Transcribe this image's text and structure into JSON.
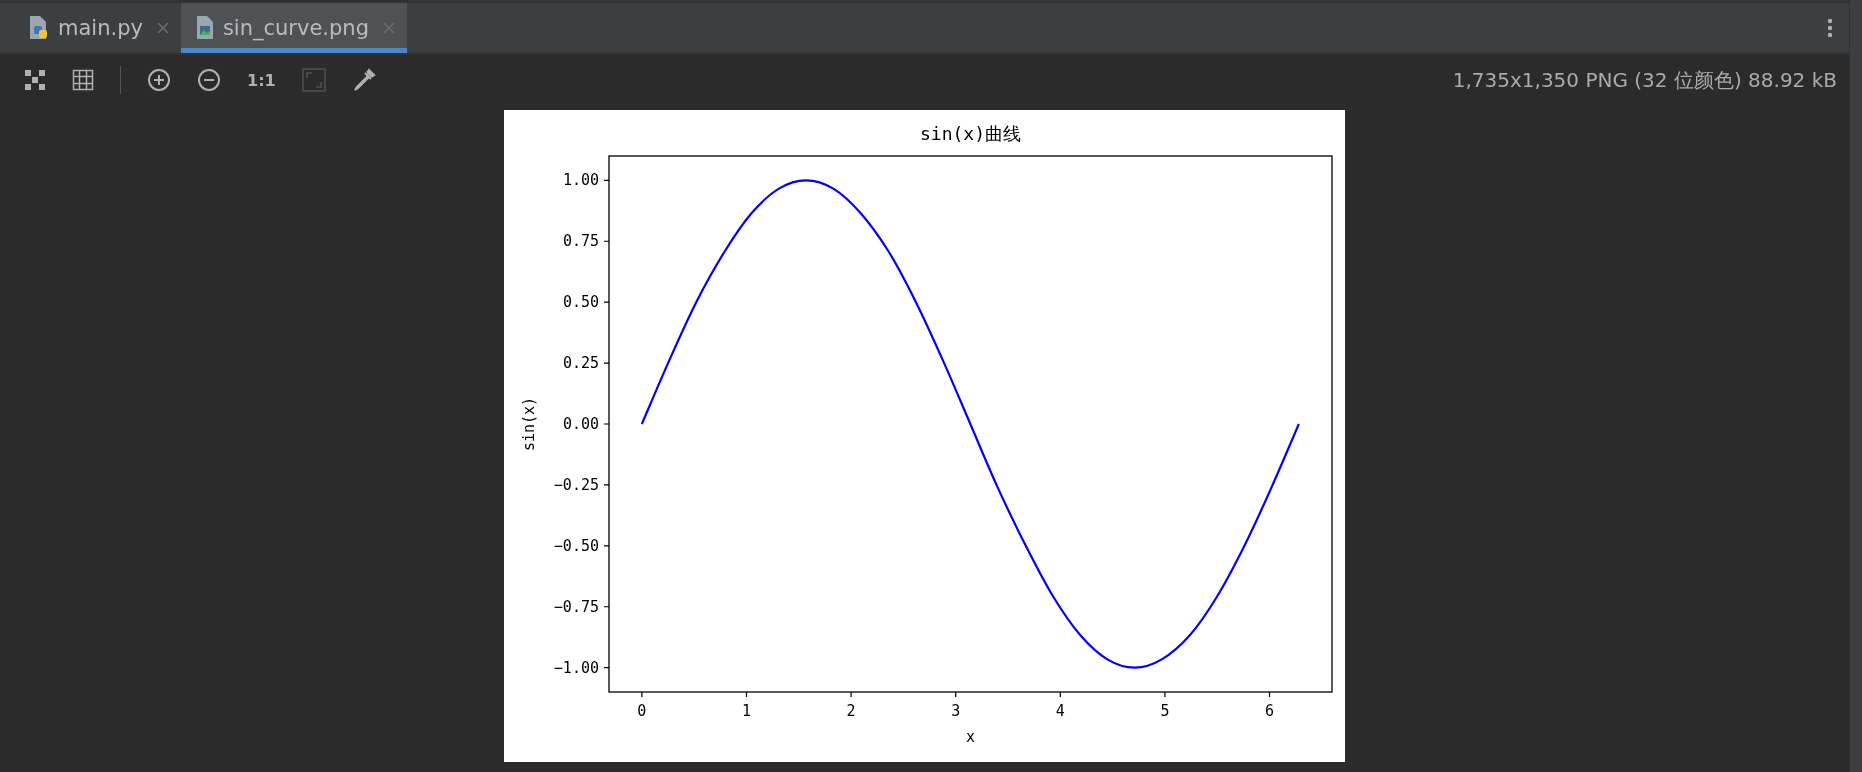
{
  "tabs": [
    {
      "label": "main.py",
      "kind": "python",
      "selected": false
    },
    {
      "label": "sin_curve.png",
      "kind": "image",
      "selected": true
    }
  ],
  "toolbar": {
    "buttons": [
      {
        "kind": "checker",
        "disabled": false
      },
      {
        "kind": "grid",
        "disabled": false
      },
      {
        "kind": "zoom_in",
        "disabled": false
      },
      {
        "kind": "zoom_out",
        "disabled": false
      },
      {
        "kind": "actual",
        "label": "1:1",
        "disabled": false
      },
      {
        "kind": "fit",
        "disabled": true
      },
      {
        "kind": "picker",
        "disabled": false
      }
    ]
  },
  "image_info": "1,735x1,350 PNG (32 位颜色) 88.92 kB",
  "chart_data": {
    "type": "line",
    "title": "sin(x)曲线",
    "xlabel": "x",
    "ylabel": "sin(x)",
    "x": [
      0,
      0.26,
      0.52,
      0.79,
      1.05,
      1.31,
      1.57,
      1.83,
      2.09,
      2.36,
      2.62,
      2.88,
      3.14,
      3.4,
      3.67,
      3.93,
      4.19,
      4.45,
      4.71,
      4.97,
      5.24,
      5.5,
      5.76,
      6.02,
      6.28
    ],
    "series": [
      {
        "color": "#0000ff",
        "values": [
          0,
          0.259,
          0.5,
          0.707,
          0.866,
          0.966,
          1,
          0.966,
          0.866,
          0.707,
          0.5,
          0.259,
          0,
          -0.259,
          -0.5,
          -0.707,
          -0.866,
          -0.966,
          -1,
          -0.966,
          -0.866,
          -0.707,
          -0.5,
          -0.259,
          0
        ]
      }
    ],
    "xlim": [
      -0.314,
      6.597
    ],
    "ylim": [
      -1.1,
      1.1
    ],
    "xticks": [
      0,
      1,
      2,
      3,
      4,
      5,
      6
    ],
    "yticks": [
      {
        "value": 1,
        "label": "1.00"
      },
      {
        "value": 0.75,
        "label": "0.75"
      },
      {
        "value": 0.5,
        "label": "0.50"
      },
      {
        "value": 0.25,
        "label": "0.25"
      },
      {
        "value": 0,
        "label": "0.00"
      },
      {
        "value": -0.25,
        "label": "−0.25"
      },
      {
        "value": -0.5,
        "label": "−0.50"
      },
      {
        "value": -0.75,
        "label": "−0.75"
      },
      {
        "value": -1,
        "label": "−1.00"
      }
    ]
  }
}
